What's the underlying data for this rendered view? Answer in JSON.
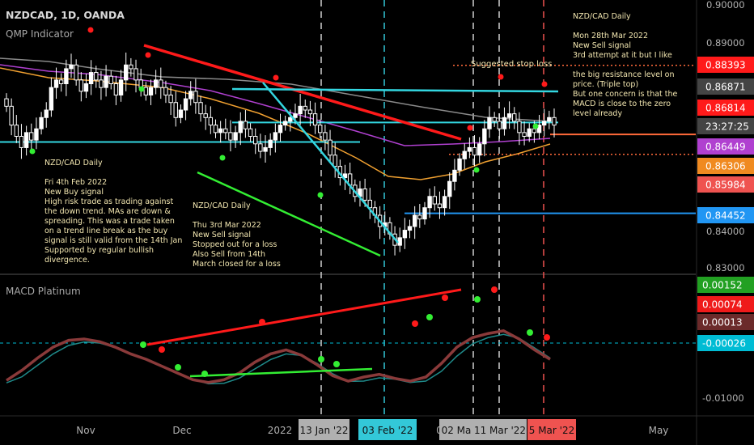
{
  "header": {
    "symbol_line": "NZDCAD, 1D, OANDA",
    "indicator_name": "QMP Indicator",
    "macd_name": "MACD Platinum"
  },
  "colors": {
    "background": "#000000",
    "up_candle": "#ffffff",
    "down_candle": "#ffffff",
    "cyan": "#33d6e0",
    "red": "#ff1a1a",
    "green": "#33ee33",
    "blue": "#2196f3",
    "orange": "#f0a030",
    "purple": "#b040d0",
    "gray_ma": "#a0a0a0",
    "macd_line": "#8a3a3a",
    "signal_line": "#1f8a8a",
    "note_text": "#f2e6b0"
  },
  "notes": [
    {
      "id": "note-feb",
      "lines": [
        "NZD/CAD Daily",
        "",
        "Fri 4th Feb 2022",
        "New Buy signal",
        "High risk trade as trading against",
        "the down trend. MAs are down &",
        "spreading. This was a trade taken",
        "on a trend line break as the buy",
        "signal is still valid from the 14th Jan",
        "Supported by regular bullish",
        "divergence."
      ]
    },
    {
      "id": "note-mar3",
      "lines": [
        "NZD/CAD Daily",
        "",
        "Thu 3rd Mar 2022",
        "New Sell signal",
        "Stopped out for a loss",
        "Also Sell from 14th",
        "March closed for a loss"
      ]
    },
    {
      "id": "note-mar28",
      "lines": [
        "NZD/CAD Daily",
        "",
        "Mon 28th Mar 2022",
        "New Sell signal",
        "3rd attempt at it but I like",
        "",
        "the big resistance level on",
        "price. (Triple top)",
        "But one concern is that the",
        "MACD is close to the zero",
        "level already"
      ]
    }
  ],
  "stop_loss_label": "Suggested stop loss",
  "chart_data": [
    {
      "type": "candlestick",
      "title": "NZDCAD, 1D, OANDA",
      "ylim": [
        0.825,
        0.9
      ],
      "y_ticks": [
        "0.90000",
        "0.89000",
        "0.84000",
        "0.83000"
      ],
      "x_ticks": [
        "Nov",
        "Dec",
        "2022",
        "02 Mar",
        "May"
      ],
      "x_highlight_labels": [
        {
          "label": "13 Jan '22",
          "color": "#b0b0b0"
        },
        {
          "label": "03 Feb '22",
          "color": "#33c8d8"
        },
        {
          "label": "02 Ma",
          "color": "#b0b0b0"
        },
        {
          "label": "11 Mar '22",
          "color": "#b0b0b0"
        },
        {
          "label": "5 Mar '22",
          "color": "#ef5350"
        }
      ],
      "price_labels": [
        {
          "value": "0.88393",
          "color": "#ff1a1a"
        },
        {
          "value": "0.86871",
          "color": "#444444"
        },
        {
          "value": "0.86814",
          "color": "#ff1a1a"
        },
        {
          "value": "23:27:25",
          "color": "#444444"
        },
        {
          "value": "0.86449",
          "color": "#b040d0"
        },
        {
          "value": "0.86306",
          "color": "#f08a20"
        },
        {
          "value": "0.85984",
          "color": "#ef5350"
        },
        {
          "value": "0.84452",
          "color": "#2196f3"
        }
      ],
      "horizontal_levels": [
        {
          "name": "stop-loss",
          "value": 0.8839,
          "color": "#ff6a3a",
          "style": "dotted"
        },
        {
          "name": "resistance",
          "value": 0.8687,
          "color": "#33d6e0",
          "style": "solid"
        },
        {
          "name": "current",
          "value": 0.8655,
          "color": "#ff6a3a",
          "style": "solid"
        },
        {
          "name": "support-left",
          "value": 0.8635,
          "color": "#33d6e0",
          "style": "solid"
        },
        {
          "name": "entry-level",
          "value": 0.8602,
          "color": "#ff6a3a",
          "style": "dotted"
        },
        {
          "name": "blue-level",
          "value": 0.8445,
          "color": "#2196f3",
          "style": "solid"
        }
      ],
      "close_series": [
        0.873,
        0.868,
        0.865,
        0.862,
        0.866,
        0.864,
        0.867,
        0.87,
        0.872,
        0.878,
        0.88,
        0.879,
        0.883,
        0.884,
        0.88,
        0.877,
        0.879,
        0.882,
        0.88,
        0.878,
        0.881,
        0.879,
        0.876,
        0.88,
        0.884,
        0.883,
        0.88,
        0.878,
        0.876,
        0.878,
        0.88,
        0.878,
        0.876,
        0.874,
        0.87,
        0.872,
        0.875,
        0.877,
        0.874,
        0.871,
        0.87,
        0.868,
        0.866,
        0.867,
        0.866,
        0.864,
        0.866,
        0.869,
        0.867,
        0.865,
        0.863,
        0.861,
        0.862,
        0.864,
        0.866,
        0.868,
        0.869,
        0.87,
        0.871,
        0.873,
        0.872,
        0.871,
        0.868,
        0.866,
        0.864,
        0.86,
        0.857,
        0.854,
        0.855,
        0.852,
        0.849,
        0.851,
        0.848,
        0.846,
        0.844,
        0.841,
        0.842,
        0.839,
        0.836,
        0.838,
        0.84,
        0.841,
        0.844,
        0.843,
        0.846,
        0.849,
        0.847,
        0.846,
        0.849,
        0.853,
        0.856,
        0.859,
        0.861,
        0.862,
        0.86,
        0.863,
        0.867,
        0.87,
        0.869,
        0.867,
        0.87,
        0.871,
        0.869,
        0.866,
        0.865,
        0.867,
        0.866,
        0.868,
        0.869,
        0.87,
        0.868
      ]
    },
    {
      "type": "line",
      "title": "MACD Platinum",
      "ylim": [
        -0.013,
        0.003
      ],
      "y_ticks": [
        "-0.01000"
      ],
      "value_labels": [
        {
          "value": "0.00152",
          "color": "#22a022"
        },
        {
          "value": "0.00074",
          "color": "#ef1a1a"
        },
        {
          "value": "0.00013",
          "color": "#6b2a2a"
        },
        {
          "value": "-0.00026",
          "color": "#00bcd4"
        }
      ],
      "series": [
        {
          "values": [
            -0.0055,
            -0.004,
            -0.0022,
            -0.0006,
            0.0004,
            0.0006,
            0.0002,
            -0.0006,
            -0.0016,
            -0.0024,
            -0.0034,
            -0.0044,
            -0.0054,
            -0.0058,
            -0.0054,
            -0.0044,
            -0.0028,
            -0.0016,
            -0.001,
            -0.0018,
            -0.0032,
            -0.0048,
            -0.0056,
            -0.005,
            -0.0046,
            -0.0052,
            -0.0056,
            -0.005,
            -0.003,
            -0.0006,
            0.0008,
            0.0014,
            0.0018,
            0.0006,
            -0.001,
            -0.0024
          ]
        }
      ]
    }
  ]
}
